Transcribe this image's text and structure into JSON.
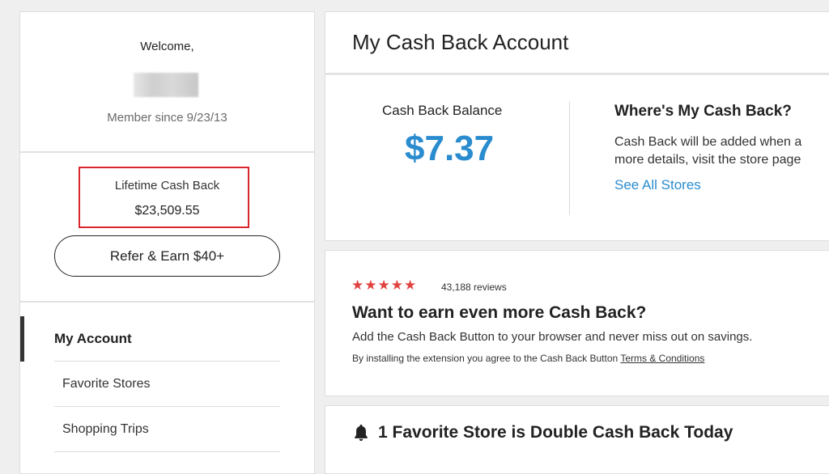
{
  "profile": {
    "welcome": "Welcome,",
    "member_since": "Member since 9/23/13"
  },
  "lifetime": {
    "label": "Lifetime Cash Back",
    "value": "$23,509.55",
    "highlight_color": "#d9262c"
  },
  "refer_button": "Refer & Earn $40+",
  "nav": {
    "items": [
      {
        "label": "My Account"
      },
      {
        "label": "Favorite Stores"
      },
      {
        "label": "Shopping Trips"
      }
    ]
  },
  "header": {
    "title": "My Cash Back Account"
  },
  "balance": {
    "label": "Cash Back Balance",
    "value": "$7.37",
    "color": "#2a8ccf"
  },
  "where": {
    "title": "Where's My Cash Back?",
    "line1": "Cash Back will be added when a",
    "line2": "more details, visit the store page",
    "link": "See All Stores"
  },
  "extension": {
    "rating_stars": 5,
    "reviews": "43,188 reviews",
    "title": "Want to earn even more Cash Back?",
    "text": "Add the Cash Back Button to your browser and never miss out on savings.",
    "terms_prefix": "By installing the extension you agree to the Cash Back Button",
    "terms_link": "Terms & Conditions",
    "star_color": "#e0423f"
  },
  "favorites": {
    "icon": "bell-icon",
    "title": "1 Favorite Store is Double Cash Back Today"
  }
}
